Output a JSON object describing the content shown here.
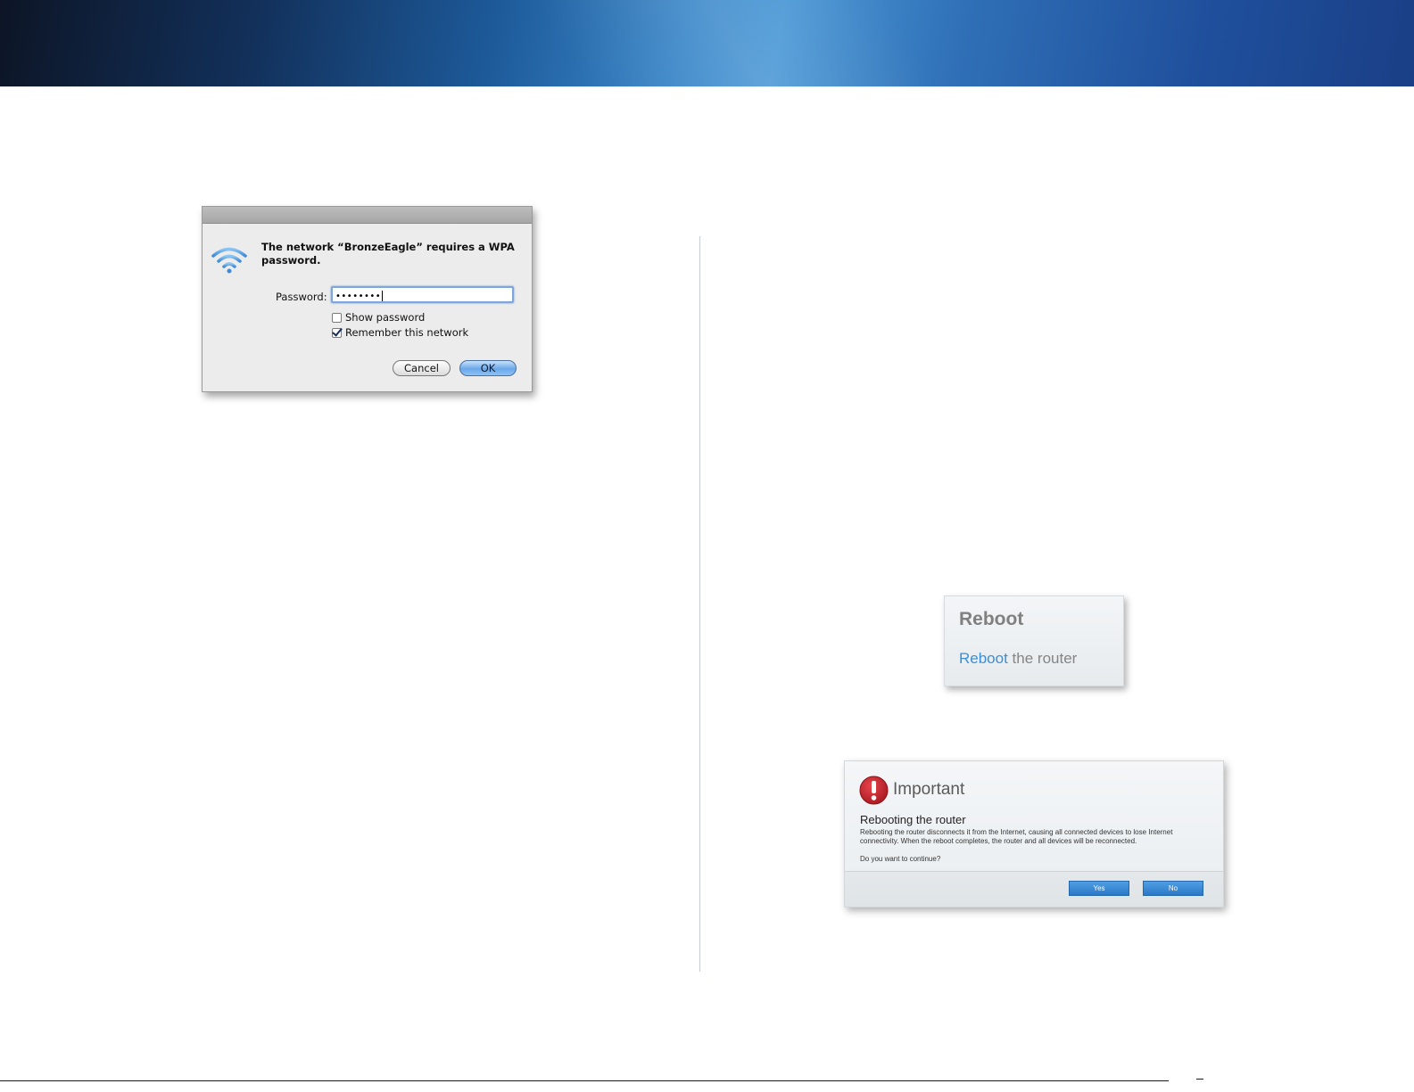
{
  "wifi_dialog": {
    "message": "The network “BronzeEagle” requires a WPA password.",
    "password_label": "Password:",
    "password_value": "••••••••",
    "show_password_label": "Show password",
    "show_password_checked": false,
    "remember_label": "Remember this network",
    "remember_checked": true,
    "cancel_label": "Cancel",
    "ok_label": "OK"
  },
  "reboot_card": {
    "title": "Reboot",
    "link_text": "Reboot",
    "suffix_text": " the router"
  },
  "important_dialog": {
    "title": "Important",
    "heading": "Rebooting the router",
    "body": "Rebooting the router disconnects it from the Internet, causing all connected devices to lose Internet connectivity. When the reboot completes, the router and all devices will be reconnected.",
    "question": "Do you want to continue?",
    "yes_label": "Yes",
    "no_label": "No"
  },
  "colors": {
    "link_blue": "#3a8fd6",
    "button_blue": "#2b78c8",
    "warning_red": "#c8202a"
  }
}
